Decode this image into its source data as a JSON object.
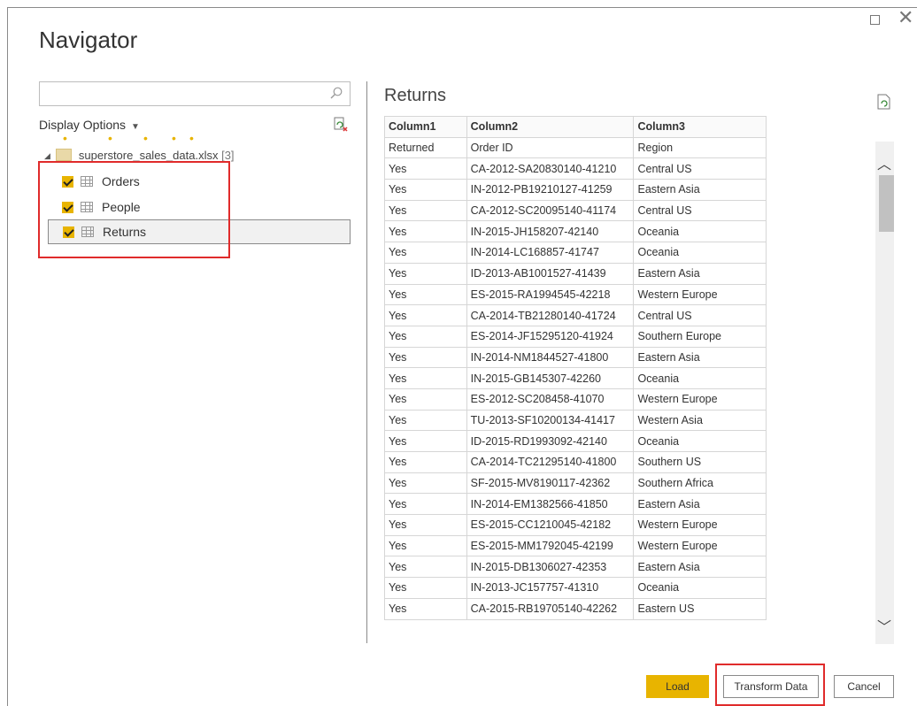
{
  "window": {
    "title": "Navigator"
  },
  "search": {
    "placeholder": "",
    "value": ""
  },
  "left_panel": {
    "display_options_label": "Display Options",
    "tree": {
      "file_name": "superstore_sales_data.xlsx",
      "file_count": "[3]",
      "items": [
        {
          "label": "Orders",
          "checked": true
        },
        {
          "label": "People",
          "checked": true
        },
        {
          "label": "Returns",
          "checked": true,
          "selected": true
        }
      ]
    }
  },
  "preview": {
    "title": "Returns",
    "columns": [
      "Column1",
      "Column2",
      "Column3"
    ],
    "rows": [
      [
        "Returned",
        "Order ID",
        "Region"
      ],
      [
        "Yes",
        "CA-2012-SA20830140-41210",
        "Central US"
      ],
      [
        "Yes",
        "IN-2012-PB19210127-41259",
        "Eastern Asia"
      ],
      [
        "Yes",
        "CA-2012-SC20095140-41174",
        "Central US"
      ],
      [
        "Yes",
        "IN-2015-JH158207-42140",
        "Oceania"
      ],
      [
        "Yes",
        "IN-2014-LC168857-41747",
        "Oceania"
      ],
      [
        "Yes",
        "ID-2013-AB1001527-41439",
        "Eastern Asia"
      ],
      [
        "Yes",
        "ES-2015-RA1994545-42218",
        "Western Europe"
      ],
      [
        "Yes",
        "CA-2014-TB21280140-41724",
        "Central US"
      ],
      [
        "Yes",
        "ES-2014-JF15295120-41924",
        "Southern Europe"
      ],
      [
        "Yes",
        "IN-2014-NM1844527-41800",
        "Eastern Asia"
      ],
      [
        "Yes",
        "IN-2015-GB145307-42260",
        "Oceania"
      ],
      [
        "Yes",
        "ES-2012-SC208458-41070",
        "Western Europe"
      ],
      [
        "Yes",
        "TU-2013-SF10200134-41417",
        "Western Asia"
      ],
      [
        "Yes",
        "ID-2015-RD1993092-42140",
        "Oceania"
      ],
      [
        "Yes",
        "CA-2014-TC21295140-41800",
        "Southern US"
      ],
      [
        "Yes",
        "SF-2015-MV8190117-42362",
        "Southern Africa"
      ],
      [
        "Yes",
        "IN-2014-EM1382566-41850",
        "Eastern Asia"
      ],
      [
        "Yes",
        "ES-2015-CC1210045-42182",
        "Western Europe"
      ],
      [
        "Yes",
        "ES-2015-MM1792045-42199",
        "Western Europe"
      ],
      [
        "Yes",
        "IN-2015-DB1306027-42353",
        "Eastern Asia"
      ],
      [
        "Yes",
        "IN-2013-JC157757-41310",
        "Oceania"
      ],
      [
        "Yes",
        "CA-2015-RB19705140-42262",
        "Eastern US"
      ]
    ]
  },
  "footer": {
    "load_label": "Load",
    "transform_label": "Transform Data",
    "cancel_label": "Cancel"
  },
  "colors": {
    "accent": "#e8b400",
    "highlight_box": "#e02b2b"
  }
}
